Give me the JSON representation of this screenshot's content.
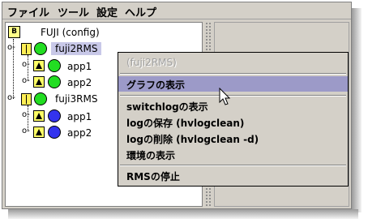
{
  "menubar": {
    "file": "ファイル",
    "tools": "ツール",
    "settings": "設定",
    "help": "ヘルプ"
  },
  "tree": {
    "root": "FUJI (config)",
    "nodes": [
      {
        "label": "fuji2RMS",
        "color": "#22dd22",
        "apps": [
          {
            "label": "app1",
            "color": "#22dd22"
          },
          {
            "label": "app2",
            "color": "#22dd22"
          }
        ]
      },
      {
        "label": "fuji3RMS",
        "color": "#22dd22",
        "apps": [
          {
            "label": "app1",
            "color": "#3333ee"
          },
          {
            "label": "app2",
            "color": "#3333ee"
          }
        ]
      }
    ]
  },
  "context_menu": {
    "title": "(fuji2RMS)",
    "items": [
      "グラフの表示",
      "switchlogの表示",
      "logの保存 (hvlogclean)",
      "logの削除 (hvlogclean -d)",
      "環境の表示",
      "RMSの停止"
    ]
  },
  "colors": {
    "selection": "#c8c8e8",
    "menu_highlight": "#9c9ac8",
    "online": "#22dd22",
    "offline": "#3333ee"
  }
}
